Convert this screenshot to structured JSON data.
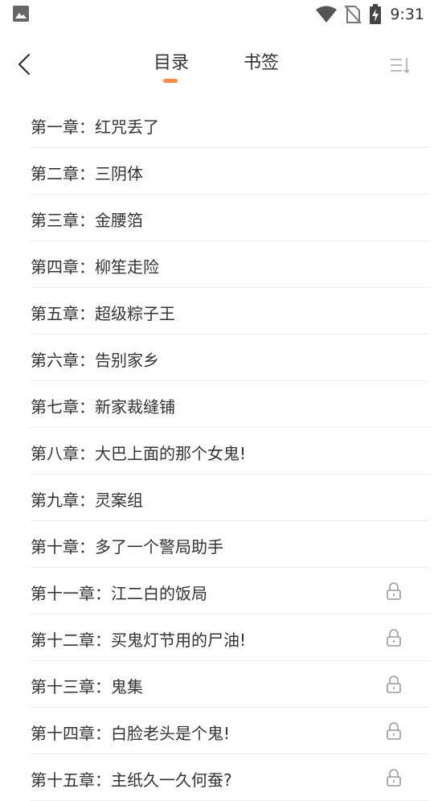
{
  "status_bar": {
    "time": "9:31",
    "icons": [
      "image-icon",
      "wifi-icon",
      "no-sim-icon",
      "battery-charging-icon"
    ]
  },
  "nav": {
    "back_icon": "back-arrow-icon",
    "tabs": [
      {
        "label": "目录",
        "active": true
      },
      {
        "label": "书签",
        "active": false
      }
    ],
    "sort_icon": "sort-icon",
    "accent_color": "#ff8a45"
  },
  "chapters": [
    {
      "title": "第一章：红咒丢了",
      "locked": false
    },
    {
      "title": "第二章：三阴体",
      "locked": false
    },
    {
      "title": "第三章：金腰箔",
      "locked": false
    },
    {
      "title": "第四章：柳笙走险",
      "locked": false
    },
    {
      "title": "第五章：超级粽子王",
      "locked": false
    },
    {
      "title": "第六章：告别家乡",
      "locked": false
    },
    {
      "title": "第七章：新家裁缝铺",
      "locked": false
    },
    {
      "title": "第八章：大巴上面的那个女鬼!",
      "locked": false
    },
    {
      "title": "第九章：灵案组",
      "locked": false
    },
    {
      "title": "第十章：多了一个警局助手",
      "locked": false
    },
    {
      "title": "第十一章：江二白的饭局",
      "locked": true
    },
    {
      "title": "第十二章：买鬼灯节用的尸油!",
      "locked": true
    },
    {
      "title": "第十三章：鬼集",
      "locked": true
    },
    {
      "title": "第十四章：白脸老头是个鬼!",
      "locked": true
    },
    {
      "title": "第十五章：主纸久一久何蚕?",
      "locked": true
    }
  ]
}
